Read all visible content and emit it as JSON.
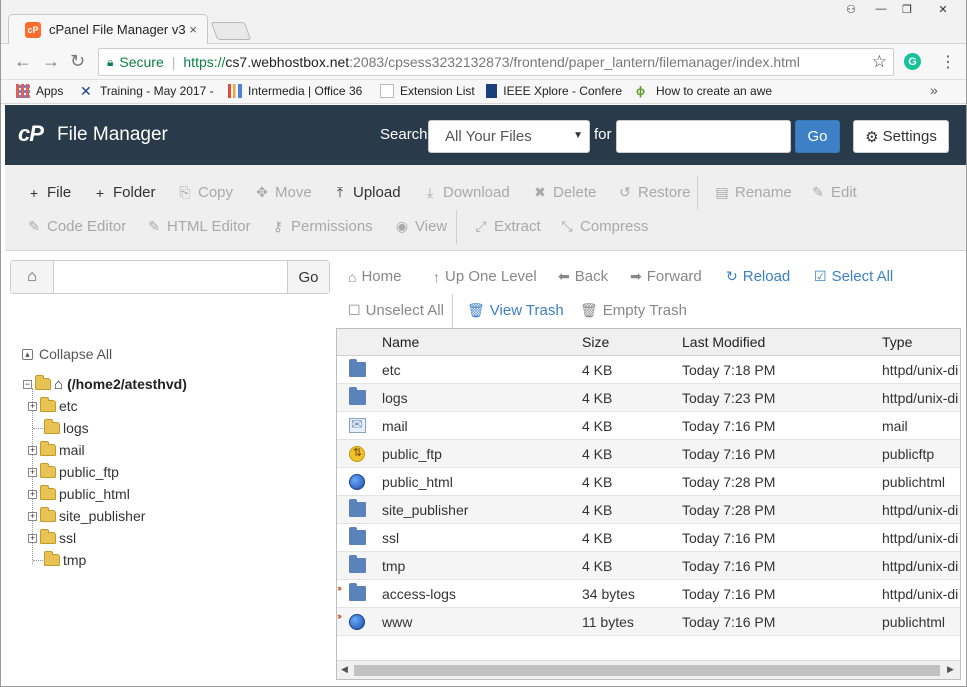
{
  "browser": {
    "tab_title": "cPanel File Manager v3",
    "tab_favicon": "cP",
    "tab_close": "×",
    "window_controls": {
      "user": "⚇",
      "minimize": "—",
      "maximize": "❐",
      "close": "✕"
    },
    "address": {
      "secure_label": "Secure",
      "scheme": "https://",
      "host": "cs7.webhostbox.net",
      "path": ":2083/cpsess3232132873/frontend/paper_lantern/filemanager/index.html"
    },
    "bookmarks": [
      {
        "label": "Apps",
        "icon": "apps-grid-icon"
      },
      {
        "label": "Training - May 2017 -",
        "icon": "training-icon"
      },
      {
        "label": "Intermedia | Office 36",
        "icon": "intermedia-icon"
      },
      {
        "label": "Extension List",
        "icon": "page-icon"
      },
      {
        "label": "IEEE Xplore - Confere",
        "icon": "ieee-icon"
      },
      {
        "label": "How to create an awe",
        "icon": "howto-icon"
      }
    ],
    "bookmarks_more": "»"
  },
  "header": {
    "logo": "cP",
    "title": "File Manager",
    "search_label": "Search",
    "search_scope": "All Your Files",
    "for_label": "for",
    "go_label": "Go",
    "settings_label": "Settings"
  },
  "toolbar": {
    "row1": [
      {
        "label": "File",
        "icon": "+",
        "enabled": true
      },
      {
        "label": "Folder",
        "icon": "+",
        "enabled": true
      },
      {
        "label": "Copy",
        "icon": "⎘",
        "enabled": false
      },
      {
        "label": "Move",
        "icon": "✥",
        "enabled": false
      },
      {
        "label": "Upload",
        "icon": "⤒",
        "enabled": true
      },
      {
        "label": "Download",
        "icon": "⤓",
        "enabled": false
      },
      {
        "label": "Delete",
        "icon": "✖",
        "enabled": false
      },
      {
        "label": "Restore",
        "icon": "↺",
        "enabled": false
      },
      {
        "label": "Rename",
        "icon": "▤",
        "enabled": false
      },
      {
        "label": "Edit",
        "icon": "✎",
        "enabled": false
      }
    ],
    "row2": [
      {
        "label": "Code Editor",
        "icon": "✎",
        "enabled": false
      },
      {
        "label": "HTML Editor",
        "icon": "✎",
        "enabled": false
      },
      {
        "label": "Permissions",
        "icon": "⚷",
        "enabled": false
      },
      {
        "label": "View",
        "icon": "◉",
        "enabled": false
      },
      {
        "label": "Extract",
        "icon": "⤢",
        "enabled": false
      },
      {
        "label": "Compress",
        "icon": "⤡",
        "enabled": false
      }
    ]
  },
  "left": {
    "home_icon": "⌂",
    "path_value": "",
    "go_label": "Go",
    "collapse_label": "Collapse All",
    "root_label": "(/home2/atesthvd)",
    "tree": [
      {
        "label": "etc",
        "expandable": true
      },
      {
        "label": "logs",
        "expandable": false
      },
      {
        "label": "mail",
        "expandable": true
      },
      {
        "label": "public_ftp",
        "expandable": true
      },
      {
        "label": "public_html",
        "expandable": true
      },
      {
        "label": "site_publisher",
        "expandable": true
      },
      {
        "label": "ssl",
        "expandable": true
      },
      {
        "label": "tmp",
        "expandable": false
      }
    ]
  },
  "nav": {
    "home": "Home",
    "up": "Up One Level",
    "back": "Back",
    "forward": "Forward",
    "reload": "Reload",
    "select_all": "Select All",
    "unselect_all": "Unselect All",
    "view_trash": "View Trash",
    "empty_trash": "Empty Trash"
  },
  "table": {
    "columns": [
      "Name",
      "Size",
      "Last Modified",
      "Type"
    ],
    "rows": [
      {
        "icon": "folder",
        "name": "etc",
        "size": "4 KB",
        "modified": "Today 7:18 PM",
        "type": "httpd/unix-di",
        "link": false
      },
      {
        "icon": "folder",
        "name": "logs",
        "size": "4 KB",
        "modified": "Today 7:23 PM",
        "type": "httpd/unix-di",
        "link": false
      },
      {
        "icon": "mail",
        "name": "mail",
        "size": "4 KB",
        "modified": "Today 7:16 PM",
        "type": "mail",
        "link": false
      },
      {
        "icon": "ftp",
        "name": "public_ftp",
        "size": "4 KB",
        "modified": "Today 7:16 PM",
        "type": "publicftp",
        "link": false
      },
      {
        "icon": "globe",
        "name": "public_html",
        "size": "4 KB",
        "modified": "Today 7:28 PM",
        "type": "publichtml",
        "link": false
      },
      {
        "icon": "folder",
        "name": "site_publisher",
        "size": "4 KB",
        "modified": "Today 7:28 PM",
        "type": "httpd/unix-di",
        "link": false
      },
      {
        "icon": "folder",
        "name": "ssl",
        "size": "4 KB",
        "modified": "Today 7:16 PM",
        "type": "httpd/unix-di",
        "link": false
      },
      {
        "icon": "folder",
        "name": "tmp",
        "size": "4 KB",
        "modified": "Today 7:16 PM",
        "type": "httpd/unix-di",
        "link": false
      },
      {
        "icon": "folder",
        "name": "access-logs",
        "size": "34 bytes",
        "modified": "Today 7:16 PM",
        "type": "httpd/unix-di",
        "link": true
      },
      {
        "icon": "globe",
        "name": "www",
        "size": "11 bytes",
        "modified": "Today 7:16 PM",
        "type": "publichtml",
        "link": true
      }
    ]
  }
}
